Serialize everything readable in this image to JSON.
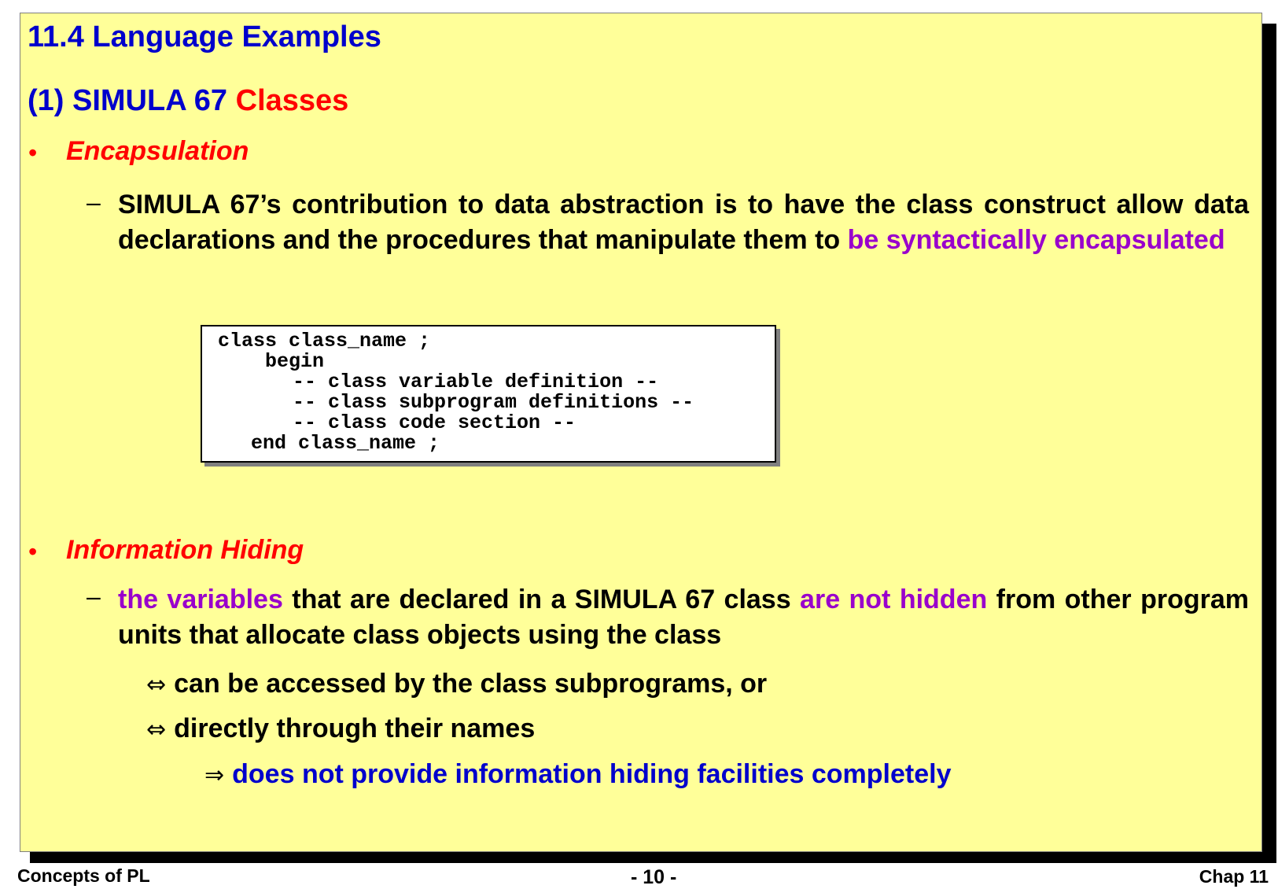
{
  "title": "11.4 Language Examples",
  "subtitle": {
    "prefix": "(1) SIMULA 67",
    "highlight": "Classes"
  },
  "bullets": [
    {
      "marker": "•",
      "label": "Encapsulation",
      "sub": {
        "marker": "–",
        "text_plain": "SIMULA 67’s contribution to data abstraction is to have the class construct allow data declarations and the procedures that manipulate them to ",
        "text_highlight": "be syntactically encapsulated"
      }
    },
    {
      "marker": "•",
      "label": "Information Hiding",
      "sub": {
        "marker": "–",
        "part1_highlight": "the variables",
        "part2": " that are declared in a SIMULA 67 class ",
        "part3_highlight": "are not hidden",
        "part4": " from other program units that allocate class objects using the class"
      }
    }
  ],
  "code_lines": [
    "class class_name ;",
    "begin",
    "-- class variable definition --",
    "-- class subprogram definitions --",
    "-- class code section --",
    "end class_name ;"
  ],
  "access_items": [
    {
      "arrow": "⇔",
      "text": "can be accessed by the class subprograms, or"
    },
    {
      "arrow": "⇔",
      "text": "directly through their names"
    }
  ],
  "conclusion": {
    "arrow": "⇒",
    "text": "does not provide information hiding facilities completely"
  },
  "footer": {
    "left": "Concepts of PL",
    "center": "- 10 -",
    "right": "Chap 11"
  },
  "colors": {
    "background": "#ffff99",
    "heading": "#0000cc",
    "accent_red": "#ff0000",
    "accent_purple": "#9900cc"
  }
}
